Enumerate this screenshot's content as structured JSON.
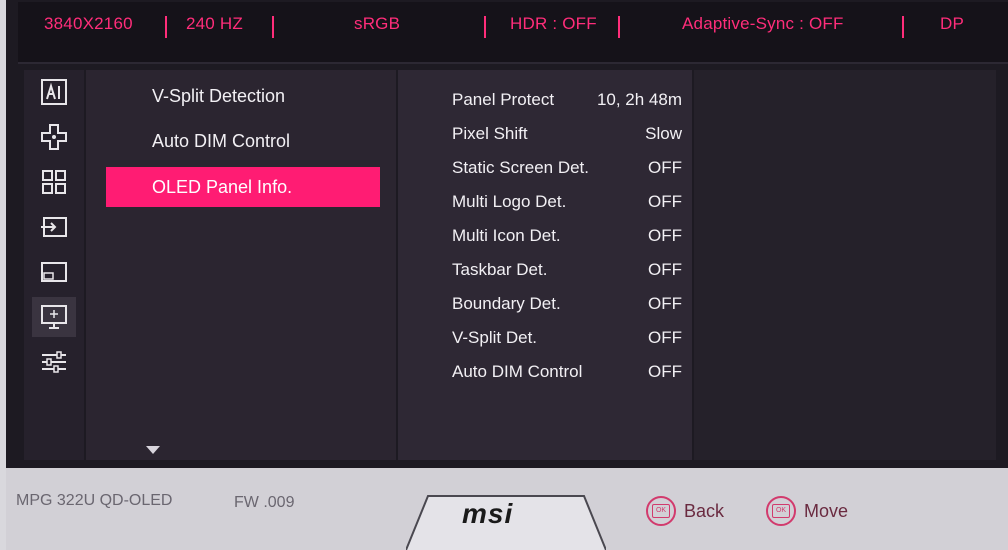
{
  "status_bar": {
    "resolution": "3840X2160",
    "refresh": "240 HZ",
    "color_space": "sRGB",
    "hdr": "HDR : OFF",
    "adaptive_sync": "Adaptive-Sync : OFF",
    "input": "DP"
  },
  "rail": {
    "icons": [
      "ai-icon",
      "gamepad-icon",
      "grid-icon",
      "input-icon",
      "pip-icon",
      "display-settings-icon",
      "sliders-icon"
    ],
    "active_index": 5
  },
  "menu": {
    "items": [
      {
        "label": "V-Split Detection"
      },
      {
        "label": "Auto DIM Control"
      },
      {
        "label": "OLED Panel Info."
      }
    ],
    "selected_index": 2
  },
  "panel_info": {
    "rows": [
      {
        "label": "Panel Protect",
        "value": "10, 2h 48m"
      },
      {
        "label": "Pixel Shift",
        "value": "Slow"
      },
      {
        "label": "Static Screen Det.",
        "value": "OFF"
      },
      {
        "label": "Multi Logo Det.",
        "value": "OFF"
      },
      {
        "label": "Multi Icon Det.",
        "value": "OFF"
      },
      {
        "label": "Taskbar Det.",
        "value": "OFF"
      },
      {
        "label": "Boundary Det.",
        "value": "OFF"
      },
      {
        "label": "V-Split Det.",
        "value": "OFF"
      },
      {
        "label": "Auto DIM Control",
        "value": "OFF"
      }
    ]
  },
  "footer": {
    "model": "MPG 322U QD-OLED",
    "firmware": "FW .009",
    "logo": "msi",
    "back_label": "Back",
    "move_label": "Move",
    "button_glyph": "OK"
  },
  "colors": {
    "accent": "#ff1c73",
    "status_text": "#ff2d7a"
  }
}
